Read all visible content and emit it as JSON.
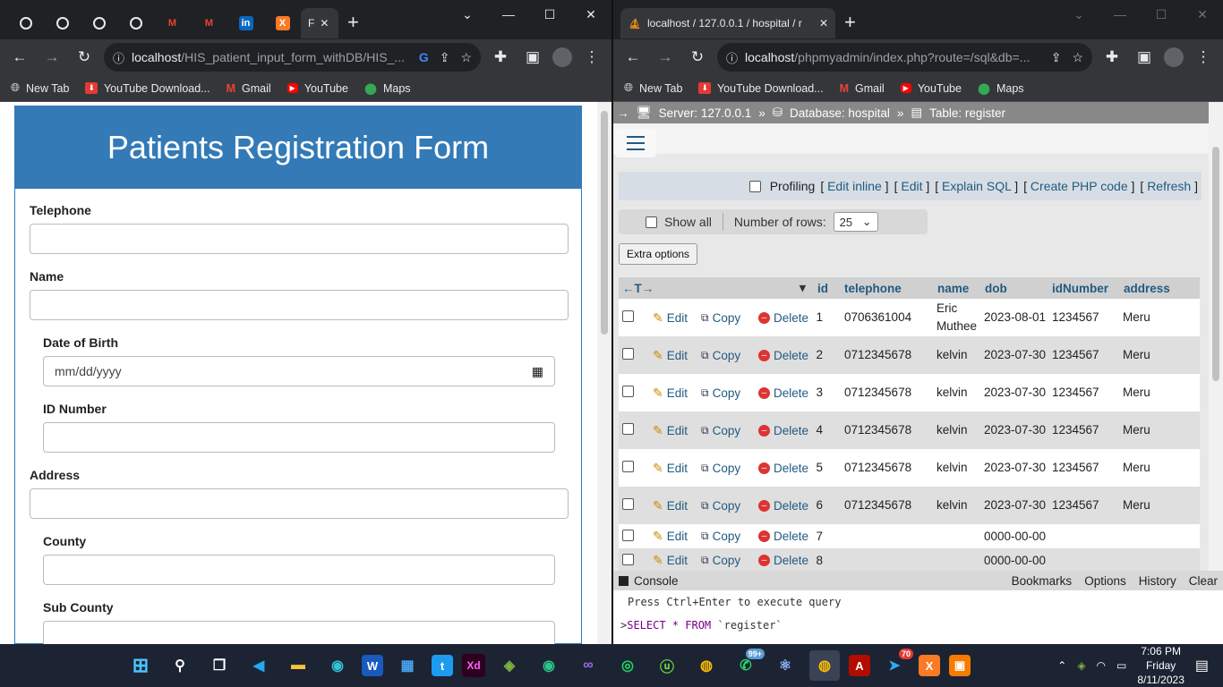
{
  "left": {
    "tabs": [
      {
        "icon": "chrome-icon",
        "label": ""
      },
      {
        "icon": "chrome-icon",
        "label": ""
      },
      {
        "icon": "chrome-icon",
        "label": ""
      },
      {
        "icon": "chrome-icon",
        "label": ""
      },
      {
        "icon": "chrome-icon",
        "label": ""
      },
      {
        "icon": "gmail-icon",
        "label": ""
      },
      {
        "icon": "gmail-icon",
        "label": ""
      },
      {
        "icon": "linkedin-icon",
        "label": ""
      },
      {
        "icon": "xampp-icon",
        "label": ""
      }
    ],
    "active_tab_label": "F",
    "url_host": "localhost",
    "url_path": "/HIS_patient_input_form_withDB/HIS_...",
    "form": {
      "title": "Patients Registration Form",
      "telephone_label": "Telephone",
      "name_label": "Name",
      "dob_label": "Date of Birth",
      "dob_placeholder": "mm/dd/yyyy",
      "id_label": "ID Number",
      "address_label": "Address",
      "county_label": "County",
      "subcounty_label": "Sub County"
    }
  },
  "bookmarks": [
    {
      "icon": "globe-icon",
      "label": "New Tab"
    },
    {
      "icon": "download-icon",
      "label": "YouTube Download..."
    },
    {
      "icon": "gmail-icon",
      "label": "Gmail"
    },
    {
      "icon": "youtube-icon",
      "label": "YouTube"
    },
    {
      "icon": "maps-icon",
      "label": "Maps"
    }
  ],
  "right": {
    "tab_label": "localhost / 127.0.0.1 / hospital / r",
    "url_host": "localhost",
    "url_path": "/phpmyadmin/index.php?route=/sql&db=...",
    "breadcrumb": {
      "server": "Server: 127.0.0.1",
      "database": "Database: hospital",
      "table": "Table: register"
    },
    "profiling": "Profiling",
    "links": [
      "Edit inline",
      "Edit",
      "Explain SQL",
      "Create PHP code",
      "Refresh"
    ],
    "show_all": "Show all",
    "num_rows_label": "Number of rows:",
    "num_rows_value": "25",
    "extra_options": "Extra options",
    "columns": [
      "id",
      "telephone",
      "name",
      "dob",
      "idNumber",
      "address"
    ],
    "actions": {
      "edit": "Edit",
      "copy": "Copy",
      "delete": "Delete"
    },
    "rows": [
      {
        "id": "1",
        "telephone": "0706361004",
        "name": "Eric Muthee",
        "dob": "2023-08-01",
        "idNumber": "1234567",
        "address": "Meru"
      },
      {
        "id": "2",
        "telephone": "0712345678",
        "name": "kelvin",
        "dob": "2023-07-30",
        "idNumber": "1234567",
        "address": "Meru"
      },
      {
        "id": "3",
        "telephone": "0712345678",
        "name": "kelvin",
        "dob": "2023-07-30",
        "idNumber": "1234567",
        "address": "Meru"
      },
      {
        "id": "4",
        "telephone": "0712345678",
        "name": "kelvin",
        "dob": "2023-07-30",
        "idNumber": "1234567",
        "address": "Meru"
      },
      {
        "id": "5",
        "telephone": "0712345678",
        "name": "kelvin",
        "dob": "2023-07-30",
        "idNumber": "1234567",
        "address": "Meru"
      },
      {
        "id": "6",
        "telephone": "0712345678",
        "name": "kelvin",
        "dob": "2023-07-30",
        "idNumber": "1234567",
        "address": "Meru"
      },
      {
        "id": "7",
        "telephone": "",
        "name": "",
        "dob": "0000-00-00",
        "idNumber": "",
        "address": ""
      },
      {
        "id": "8",
        "telephone": "",
        "name": "",
        "dob": "0000-00-00",
        "idNumber": "",
        "address": ""
      }
    ],
    "console": {
      "title": "Console",
      "tools": [
        "Bookmarks",
        "Options",
        "History",
        "Clear"
      ],
      "hint": "Press Ctrl+Enter to execute query",
      "query_keyword": "SELECT * FROM",
      "query_table": "`register`"
    }
  },
  "taskbar": {
    "icons": [
      "windows-start-icon",
      "search-icon",
      "task-view-icon",
      "vscode-icon",
      "file-explorer-icon",
      "edge-icon",
      "word-icon",
      "store-icon",
      "twitter-icon",
      "adobe-xd-icon",
      "app-icon",
      "edge-dev-icon",
      "visual-studio-icon",
      "spotify-icon",
      "upwork-icon",
      "chrome-icon",
      "whatsapp-icon",
      "atom-icon",
      "chrome-active-icon",
      "acrobat-icon",
      "telegram-icon",
      "xampp-icon",
      "app-orange-icon"
    ],
    "whatsapp_badge": "99+",
    "telegram_badge": "70",
    "time": "7:06 PM",
    "day": "Friday",
    "date": "8/11/2023"
  }
}
